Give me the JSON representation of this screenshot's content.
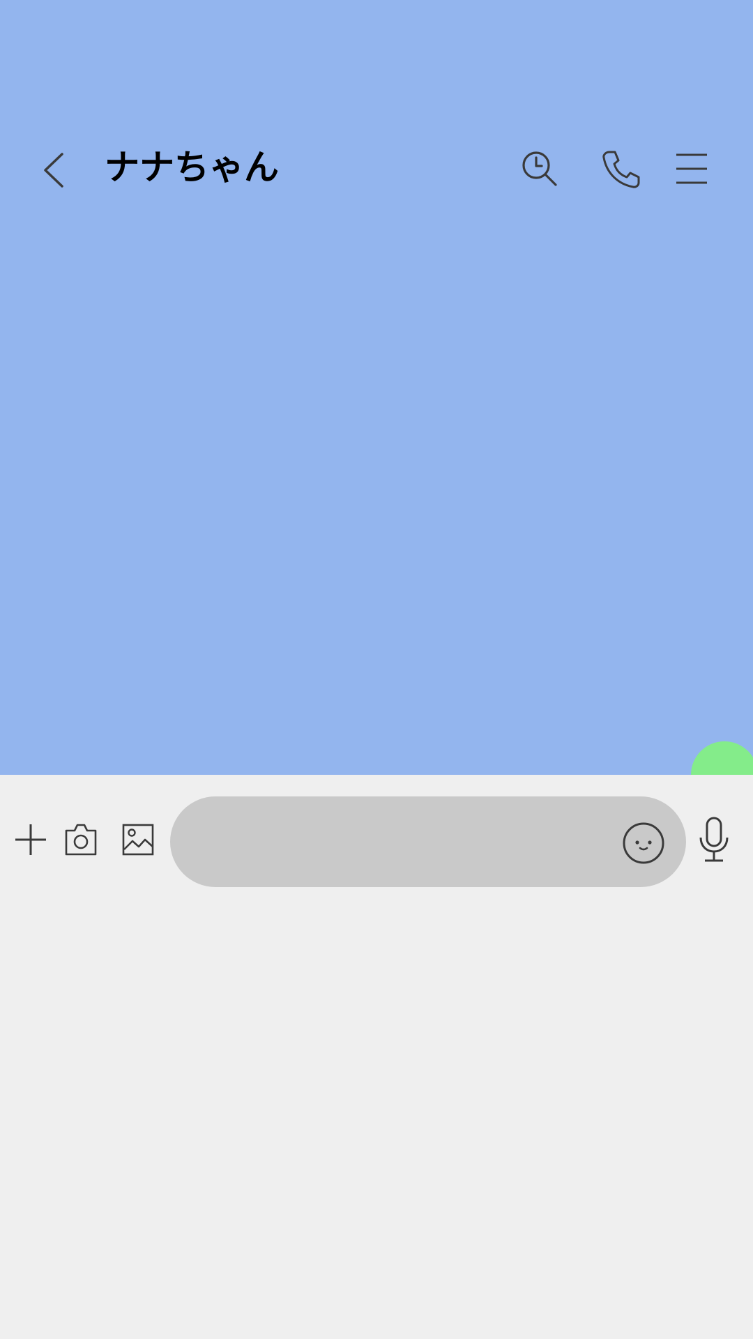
{
  "colors": {
    "chat_background": "#93b5ee",
    "input_bar_background": "#efefef",
    "message_field_background": "#c9c9c9",
    "icon_color": "#3a3a3a",
    "incoming_bubble": "#84ec8a"
  },
  "header": {
    "title": "ナナちゃん",
    "icons": [
      "back-arrow-icon",
      "history-search-icon",
      "phone-icon",
      "menu-icon"
    ]
  },
  "composer": {
    "message_value": "",
    "message_placeholder": "",
    "icons": [
      "plus-icon",
      "camera-icon",
      "image-icon",
      "emoji-icon",
      "microphone-icon"
    ]
  }
}
